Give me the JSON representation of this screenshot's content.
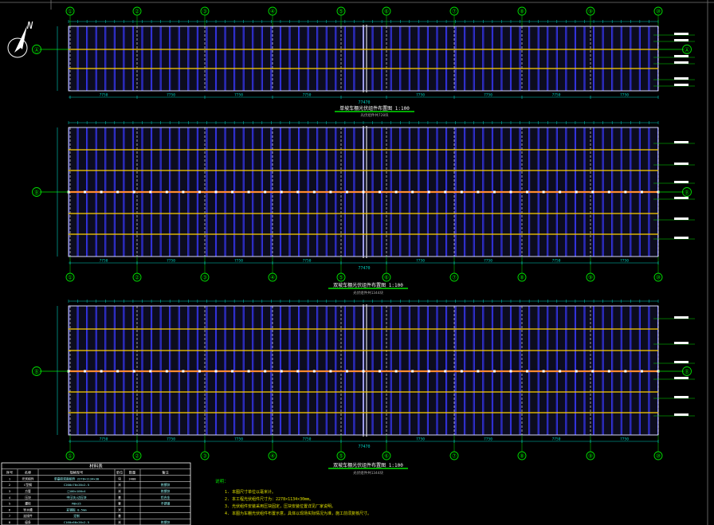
{
  "drawing": {
    "background": "#000000",
    "colors": {
      "axis": "#00e000",
      "panel_edge": "#3a3aff",
      "panel_fill": "#0c0c1e",
      "purlin": "#ffd000",
      "frame": "#ffffff",
      "ridge": "#ff8a30",
      "dim": "#00d0c0",
      "note": "#e0e000",
      "table_line": "#ffffff"
    },
    "north_label": "N",
    "plans": [
      {
        "id": "plan-1",
        "title": "单坡车棚光伏组件布置图  1:100",
        "subtitle": "光伏组件共720块",
        "axis_labels_top": [
          "①",
          "②",
          "③",
          "④",
          "⑤",
          "⑥",
          "⑦",
          "⑧",
          "⑨",
          "⑩"
        ],
        "axis_labels_bottom": [],
        "row_labels_left": [
          "Ⓐ"
        ],
        "row_labels_right": [
          "Ⓐ"
        ],
        "total_dim": "77470",
        "bay_dim": "7750"
      },
      {
        "id": "plan-2",
        "title": "双坡车棚光伏组件布置图  1:100",
        "subtitle": "光伏组件共1344块",
        "axis_labels_top": [],
        "axis_labels_bottom": [
          "①",
          "②",
          "③",
          "④",
          "⑤",
          "⑥",
          "⑦",
          "⑧",
          "⑨",
          "⑩"
        ],
        "row_labels_left": [
          "Ⓑ"
        ],
        "row_labels_right": [
          "Ⓑ"
        ],
        "total_dim": "77470",
        "bay_dim": "7750"
      },
      {
        "id": "plan-3",
        "title": "双坡车棚光伏组件布置图  1:100",
        "subtitle": "光伏组件共1344块",
        "axis_labels_top": [],
        "axis_labels_bottom": [
          "①",
          "②",
          "③",
          "④",
          "⑤",
          "⑥",
          "⑦",
          "⑧",
          "⑨",
          "⑩"
        ],
        "row_labels_left": [
          "Ⓑ"
        ],
        "row_labels_right": [
          "Ⓑ"
        ],
        "total_dim": "77470",
        "bay_dim": "7750"
      }
    ],
    "table": {
      "title": "材料表",
      "headers": [
        "序号",
        "名称",
        "规格型号",
        "单位",
        "数量",
        "备注"
      ],
      "rows": [
        [
          "1",
          "光伏组件",
          "单晶硅双面组件 2278×1134×30",
          "块",
          "3408",
          ""
        ],
        [
          "2",
          "C型钢",
          "C200×70×20×2.5",
          "米",
          "",
          "热镀锌"
        ],
        [
          "3",
          "方管",
          "□100×100×4",
          "米",
          "",
          "热镀锌"
        ],
        [
          "4",
          "压块",
          "中压块/边压块",
          "套",
          "",
          "铝合金"
        ],
        [
          "5",
          "螺栓",
          "M8×25",
          "套",
          "",
          "不锈钢"
        ],
        [
          "6",
          "导水槽",
          "彩钢板 0.5mm",
          "米",
          "",
          ""
        ],
        [
          "7",
          "连接件",
          "定制",
          "套",
          "",
          ""
        ],
        [
          "8",
          "檩条",
          "C160×60×20×2.5",
          "米",
          "",
          "热镀锌"
        ]
      ]
    },
    "notes": {
      "heading": "说明：",
      "lines": [
        "1. 本图尺寸单位以毫米计。",
        "2. 本工程光伏组件尺寸为：2278×1134×30mm。",
        "3. 光伏组件安装采用压块固定，压块安装位置详见厂家说明。",
        "4. 本图为车棚光伏组件布置示意，具体以现场实际情况为准，施工前须复核尺寸。"
      ]
    }
  }
}
